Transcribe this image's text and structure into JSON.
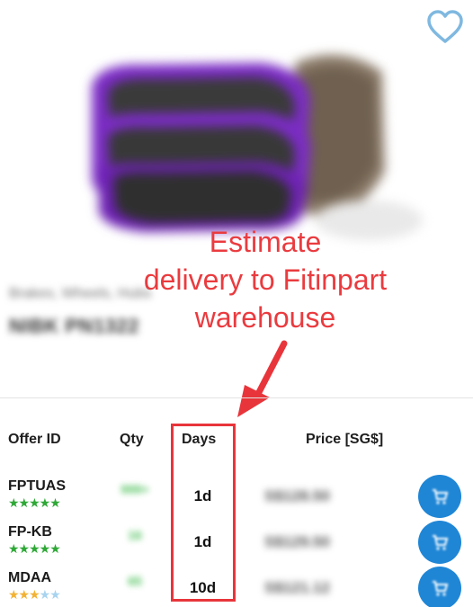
{
  "callout": {
    "lines": [
      "Estimate",
      "delivery to Fitinpart",
      "warehouse"
    ]
  },
  "product": {
    "category": "Brakes, Wheels, Hubs",
    "name": "NIBK PN1322"
  },
  "offers_table": {
    "headers": {
      "offer_id": "Offer ID",
      "qty": "Qty",
      "days": "Days",
      "price": "Price [SG$]"
    },
    "rows": [
      {
        "offer_id": "FPTUAS",
        "rating": 5,
        "qty": "999+",
        "days": "1d",
        "price": "S$128.50"
      },
      {
        "offer_id": "FP-KB",
        "rating": 5,
        "qty": "16",
        "days": "1d",
        "price": "S$129.50"
      },
      {
        "offer_id": "MDAA",
        "rating": 3,
        "qty": "65",
        "days": "10d",
        "price": "S$121.12"
      }
    ]
  },
  "colors": {
    "accent_blue": "#1f86d6",
    "annotation_red": "#ea3b3f",
    "star_green": "#2ea836",
    "star_orange": "#f2b233",
    "star_empty": "#a8d4f0",
    "pad_purple": "#7b2cc4"
  },
  "icons": {
    "wishlist": "heart-outline-icon",
    "cart": "cart-icon"
  }
}
